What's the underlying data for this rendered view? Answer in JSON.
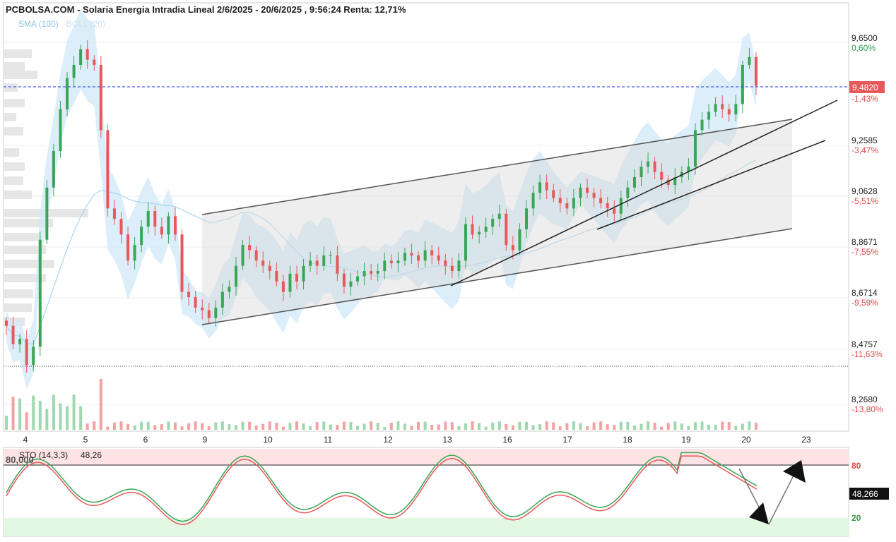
{
  "header": {
    "title": "PCBOLSA.COM - Solaria Energia Intradia Lineal 2/6/2025 - 20/6/2025 , 9:56:24 Renta: 12,71%",
    "indicator_sma": "SMA (100)",
    "indicator_boll": "BOLL (20)"
  },
  "colors": {
    "up": "#3aa655",
    "down": "#e8585a",
    "band_fill": "#cfe8f7",
    "sma_line": "#a9d6f0",
    "current_line": "#2233dd",
    "price_tag_bg": "#e8585a",
    "pct_positive": "#2e9d4e",
    "pct_negative": "#e04a4a"
  },
  "price_axis": {
    "labels": [
      {
        "price": "9,6500",
        "pct": "0,60%"
      },
      {
        "price": "9,4820",
        "pct": "-1,43%"
      },
      {
        "price": "9,2585",
        "pct": "-3,47%"
      },
      {
        "price": "9,0628",
        "pct": "-5,51%"
      },
      {
        "price": "8,8671",
        "pct": "-7,55%"
      },
      {
        "price": "8,6714",
        "pct": "-9,59%"
      },
      {
        "price": "8,4757",
        "pct": "-11,63%"
      },
      {
        "price": "8,2680",
        "pct": "-13,80%"
      }
    ],
    "current_price_tag": "9,4820"
  },
  "x_axis": {
    "labels": [
      "4",
      "5",
      "6",
      "9",
      "10",
      "11",
      "12",
      "13",
      "16",
      "17",
      "18",
      "19",
      "20",
      "23"
    ]
  },
  "stochastic": {
    "label": "STO (14,3,3)",
    "value_text": "48,26",
    "level_text": "80,000",
    "upper_label": "80",
    "lower_label": "20",
    "current_tag": "48,266"
  },
  "chart_data": {
    "type": "candlestick",
    "title": "PCBOLSA.COM - Solaria Energia Intradia Lineal 2/6/2025 - 20/6/2025 , 9:56:24 Renta: 12,71%",
    "ylim": [
      8.2,
      9.72
    ],
    "current_price": 9.482,
    "reference_line": 8.4,
    "series_close": [
      8.55,
      8.48,
      8.5,
      8.4,
      8.47,
      8.88,
      9.08,
      9.22,
      9.38,
      9.5,
      9.55,
      9.61,
      9.57,
      9.55,
      9.3,
      9.0,
      8.96,
      8.9,
      8.8,
      8.86,
      8.93,
      8.99,
      8.93,
      8.9,
      8.97,
      8.9,
      8.68,
      8.66,
      8.62,
      8.61,
      8.58,
      8.62,
      8.68,
      8.7,
      8.78,
      8.86,
      8.84,
      8.8,
      8.78,
      8.76,
      8.72,
      8.68,
      8.75,
      8.72,
      8.78,
      8.8,
      8.78,
      8.82,
      8.82,
      8.75,
      8.7,
      8.72,
      8.74,
      8.76,
      8.75,
      8.76,
      8.8,
      8.79,
      8.8,
      8.83,
      8.82,
      8.8,
      8.84,
      8.82,
      8.8,
      8.78,
      8.76,
      8.8,
      8.94,
      8.9,
      8.91,
      8.93,
      8.96,
      8.98,
      8.86,
      8.84,
      8.92,
      9.0,
      9.06,
      9.1,
      9.07,
      9.04,
      9.02,
      9.0,
      9.04,
      9.08,
      9.06,
      9.04,
      9.02,
      9.0,
      8.98,
      9.04,
      9.08,
      9.12,
      9.16,
      9.18,
      9.14,
      9.11,
      9.09,
      9.12,
      9.14,
      9.16,
      9.3,
      9.34,
      9.37,
      9.4,
      9.38,
      9.36,
      9.4,
      9.55,
      9.58,
      9.47
    ],
    "stochastic_k_range": [
      0,
      100
    ],
    "stochastic_levels": [
      20,
      80
    ],
    "stochastic_current": 48.266
  }
}
